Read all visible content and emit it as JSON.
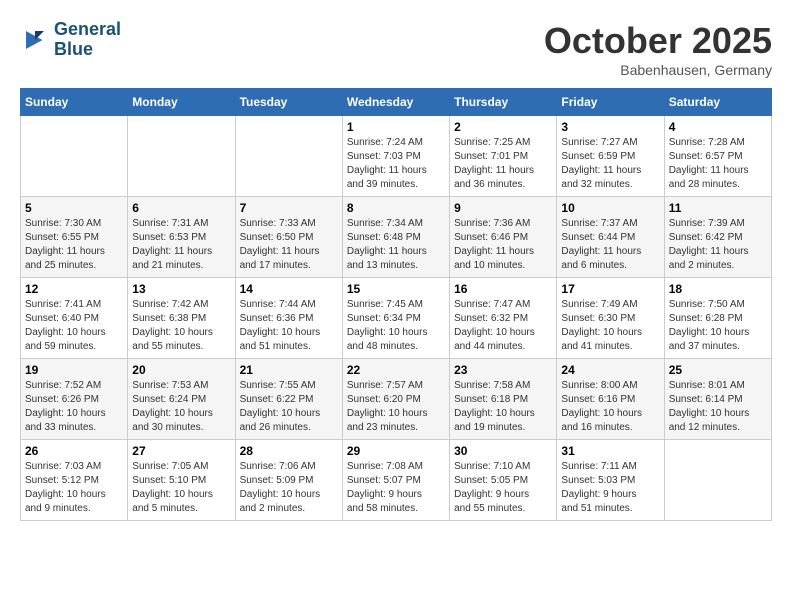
{
  "header": {
    "logo_line1": "General",
    "logo_line2": "Blue",
    "month": "October 2025",
    "location": "Babenhausen, Germany"
  },
  "weekdays": [
    "Sunday",
    "Monday",
    "Tuesday",
    "Wednesday",
    "Thursday",
    "Friday",
    "Saturday"
  ],
  "weeks": [
    [
      {
        "day": "",
        "info": ""
      },
      {
        "day": "",
        "info": ""
      },
      {
        "day": "",
        "info": ""
      },
      {
        "day": "1",
        "info": "Sunrise: 7:24 AM\nSunset: 7:03 PM\nDaylight: 11 hours\nand 39 minutes."
      },
      {
        "day": "2",
        "info": "Sunrise: 7:25 AM\nSunset: 7:01 PM\nDaylight: 11 hours\nand 36 minutes."
      },
      {
        "day": "3",
        "info": "Sunrise: 7:27 AM\nSunset: 6:59 PM\nDaylight: 11 hours\nand 32 minutes."
      },
      {
        "day": "4",
        "info": "Sunrise: 7:28 AM\nSunset: 6:57 PM\nDaylight: 11 hours\nand 28 minutes."
      }
    ],
    [
      {
        "day": "5",
        "info": "Sunrise: 7:30 AM\nSunset: 6:55 PM\nDaylight: 11 hours\nand 25 minutes."
      },
      {
        "day": "6",
        "info": "Sunrise: 7:31 AM\nSunset: 6:53 PM\nDaylight: 11 hours\nand 21 minutes."
      },
      {
        "day": "7",
        "info": "Sunrise: 7:33 AM\nSunset: 6:50 PM\nDaylight: 11 hours\nand 17 minutes."
      },
      {
        "day": "8",
        "info": "Sunrise: 7:34 AM\nSunset: 6:48 PM\nDaylight: 11 hours\nand 13 minutes."
      },
      {
        "day": "9",
        "info": "Sunrise: 7:36 AM\nSunset: 6:46 PM\nDaylight: 11 hours\nand 10 minutes."
      },
      {
        "day": "10",
        "info": "Sunrise: 7:37 AM\nSunset: 6:44 PM\nDaylight: 11 hours\nand 6 minutes."
      },
      {
        "day": "11",
        "info": "Sunrise: 7:39 AM\nSunset: 6:42 PM\nDaylight: 11 hours\nand 2 minutes."
      }
    ],
    [
      {
        "day": "12",
        "info": "Sunrise: 7:41 AM\nSunset: 6:40 PM\nDaylight: 10 hours\nand 59 minutes."
      },
      {
        "day": "13",
        "info": "Sunrise: 7:42 AM\nSunset: 6:38 PM\nDaylight: 10 hours\nand 55 minutes."
      },
      {
        "day": "14",
        "info": "Sunrise: 7:44 AM\nSunset: 6:36 PM\nDaylight: 10 hours\nand 51 minutes."
      },
      {
        "day": "15",
        "info": "Sunrise: 7:45 AM\nSunset: 6:34 PM\nDaylight: 10 hours\nand 48 minutes."
      },
      {
        "day": "16",
        "info": "Sunrise: 7:47 AM\nSunset: 6:32 PM\nDaylight: 10 hours\nand 44 minutes."
      },
      {
        "day": "17",
        "info": "Sunrise: 7:49 AM\nSunset: 6:30 PM\nDaylight: 10 hours\nand 41 minutes."
      },
      {
        "day": "18",
        "info": "Sunrise: 7:50 AM\nSunset: 6:28 PM\nDaylight: 10 hours\nand 37 minutes."
      }
    ],
    [
      {
        "day": "19",
        "info": "Sunrise: 7:52 AM\nSunset: 6:26 PM\nDaylight: 10 hours\nand 33 minutes."
      },
      {
        "day": "20",
        "info": "Sunrise: 7:53 AM\nSunset: 6:24 PM\nDaylight: 10 hours\nand 30 minutes."
      },
      {
        "day": "21",
        "info": "Sunrise: 7:55 AM\nSunset: 6:22 PM\nDaylight: 10 hours\nand 26 minutes."
      },
      {
        "day": "22",
        "info": "Sunrise: 7:57 AM\nSunset: 6:20 PM\nDaylight: 10 hours\nand 23 minutes."
      },
      {
        "day": "23",
        "info": "Sunrise: 7:58 AM\nSunset: 6:18 PM\nDaylight: 10 hours\nand 19 minutes."
      },
      {
        "day": "24",
        "info": "Sunrise: 8:00 AM\nSunset: 6:16 PM\nDaylight: 10 hours\nand 16 minutes."
      },
      {
        "day": "25",
        "info": "Sunrise: 8:01 AM\nSunset: 6:14 PM\nDaylight: 10 hours\nand 12 minutes."
      }
    ],
    [
      {
        "day": "26",
        "info": "Sunrise: 7:03 AM\nSunset: 5:12 PM\nDaylight: 10 hours\nand 9 minutes."
      },
      {
        "day": "27",
        "info": "Sunrise: 7:05 AM\nSunset: 5:10 PM\nDaylight: 10 hours\nand 5 minutes."
      },
      {
        "day": "28",
        "info": "Sunrise: 7:06 AM\nSunset: 5:09 PM\nDaylight: 10 hours\nand 2 minutes."
      },
      {
        "day": "29",
        "info": "Sunrise: 7:08 AM\nSunset: 5:07 PM\nDaylight: 9 hours\nand 58 minutes."
      },
      {
        "day": "30",
        "info": "Sunrise: 7:10 AM\nSunset: 5:05 PM\nDaylight: 9 hours\nand 55 minutes."
      },
      {
        "day": "31",
        "info": "Sunrise: 7:11 AM\nSunset: 5:03 PM\nDaylight: 9 hours\nand 51 minutes."
      },
      {
        "day": "",
        "info": ""
      }
    ]
  ]
}
